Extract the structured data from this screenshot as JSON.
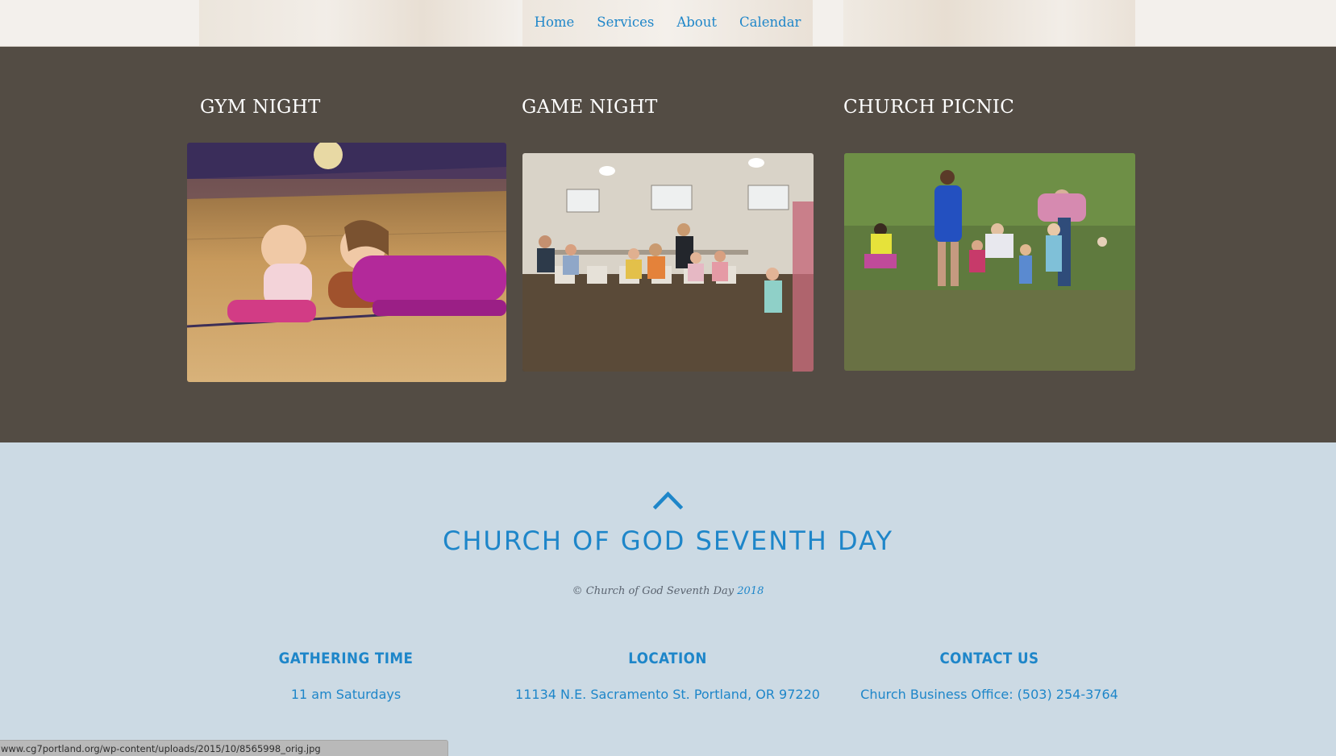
{
  "nav": {
    "items": [
      {
        "label": "Home"
      },
      {
        "label": "Services"
      },
      {
        "label": "About"
      },
      {
        "label": "Calendar"
      }
    ]
  },
  "events": [
    {
      "title": "GYM NIGHT"
    },
    {
      "title": "GAME NIGHT"
    },
    {
      "title": "CHURCH PICNIC"
    }
  ],
  "footer": {
    "church_name": "CHURCH OF GOD SEVENTH DAY",
    "copyright_prefix": "© Church of God Seventh Day ",
    "copyright_year": "2018",
    "columns": [
      {
        "heading": "GATHERING TIME",
        "text": "11 am Saturdays"
      },
      {
        "heading": "LOCATION",
        "text": "11134 N.E. Sacramento St. Portland, OR 97220"
      },
      {
        "heading": "CONTACT US",
        "text": "Church Business Office: (503) 254-3764"
      }
    ]
  },
  "status_bar": {
    "url": "www.cg7portland.org/wp-content/uploads/2015/10/8565998_orig.jpg"
  },
  "colors": {
    "accent": "#1e86c9",
    "events_bg": "#534c44",
    "footer_bg": "#ccdae4"
  },
  "icons": {
    "scroll_top": "chevron-up-icon"
  }
}
